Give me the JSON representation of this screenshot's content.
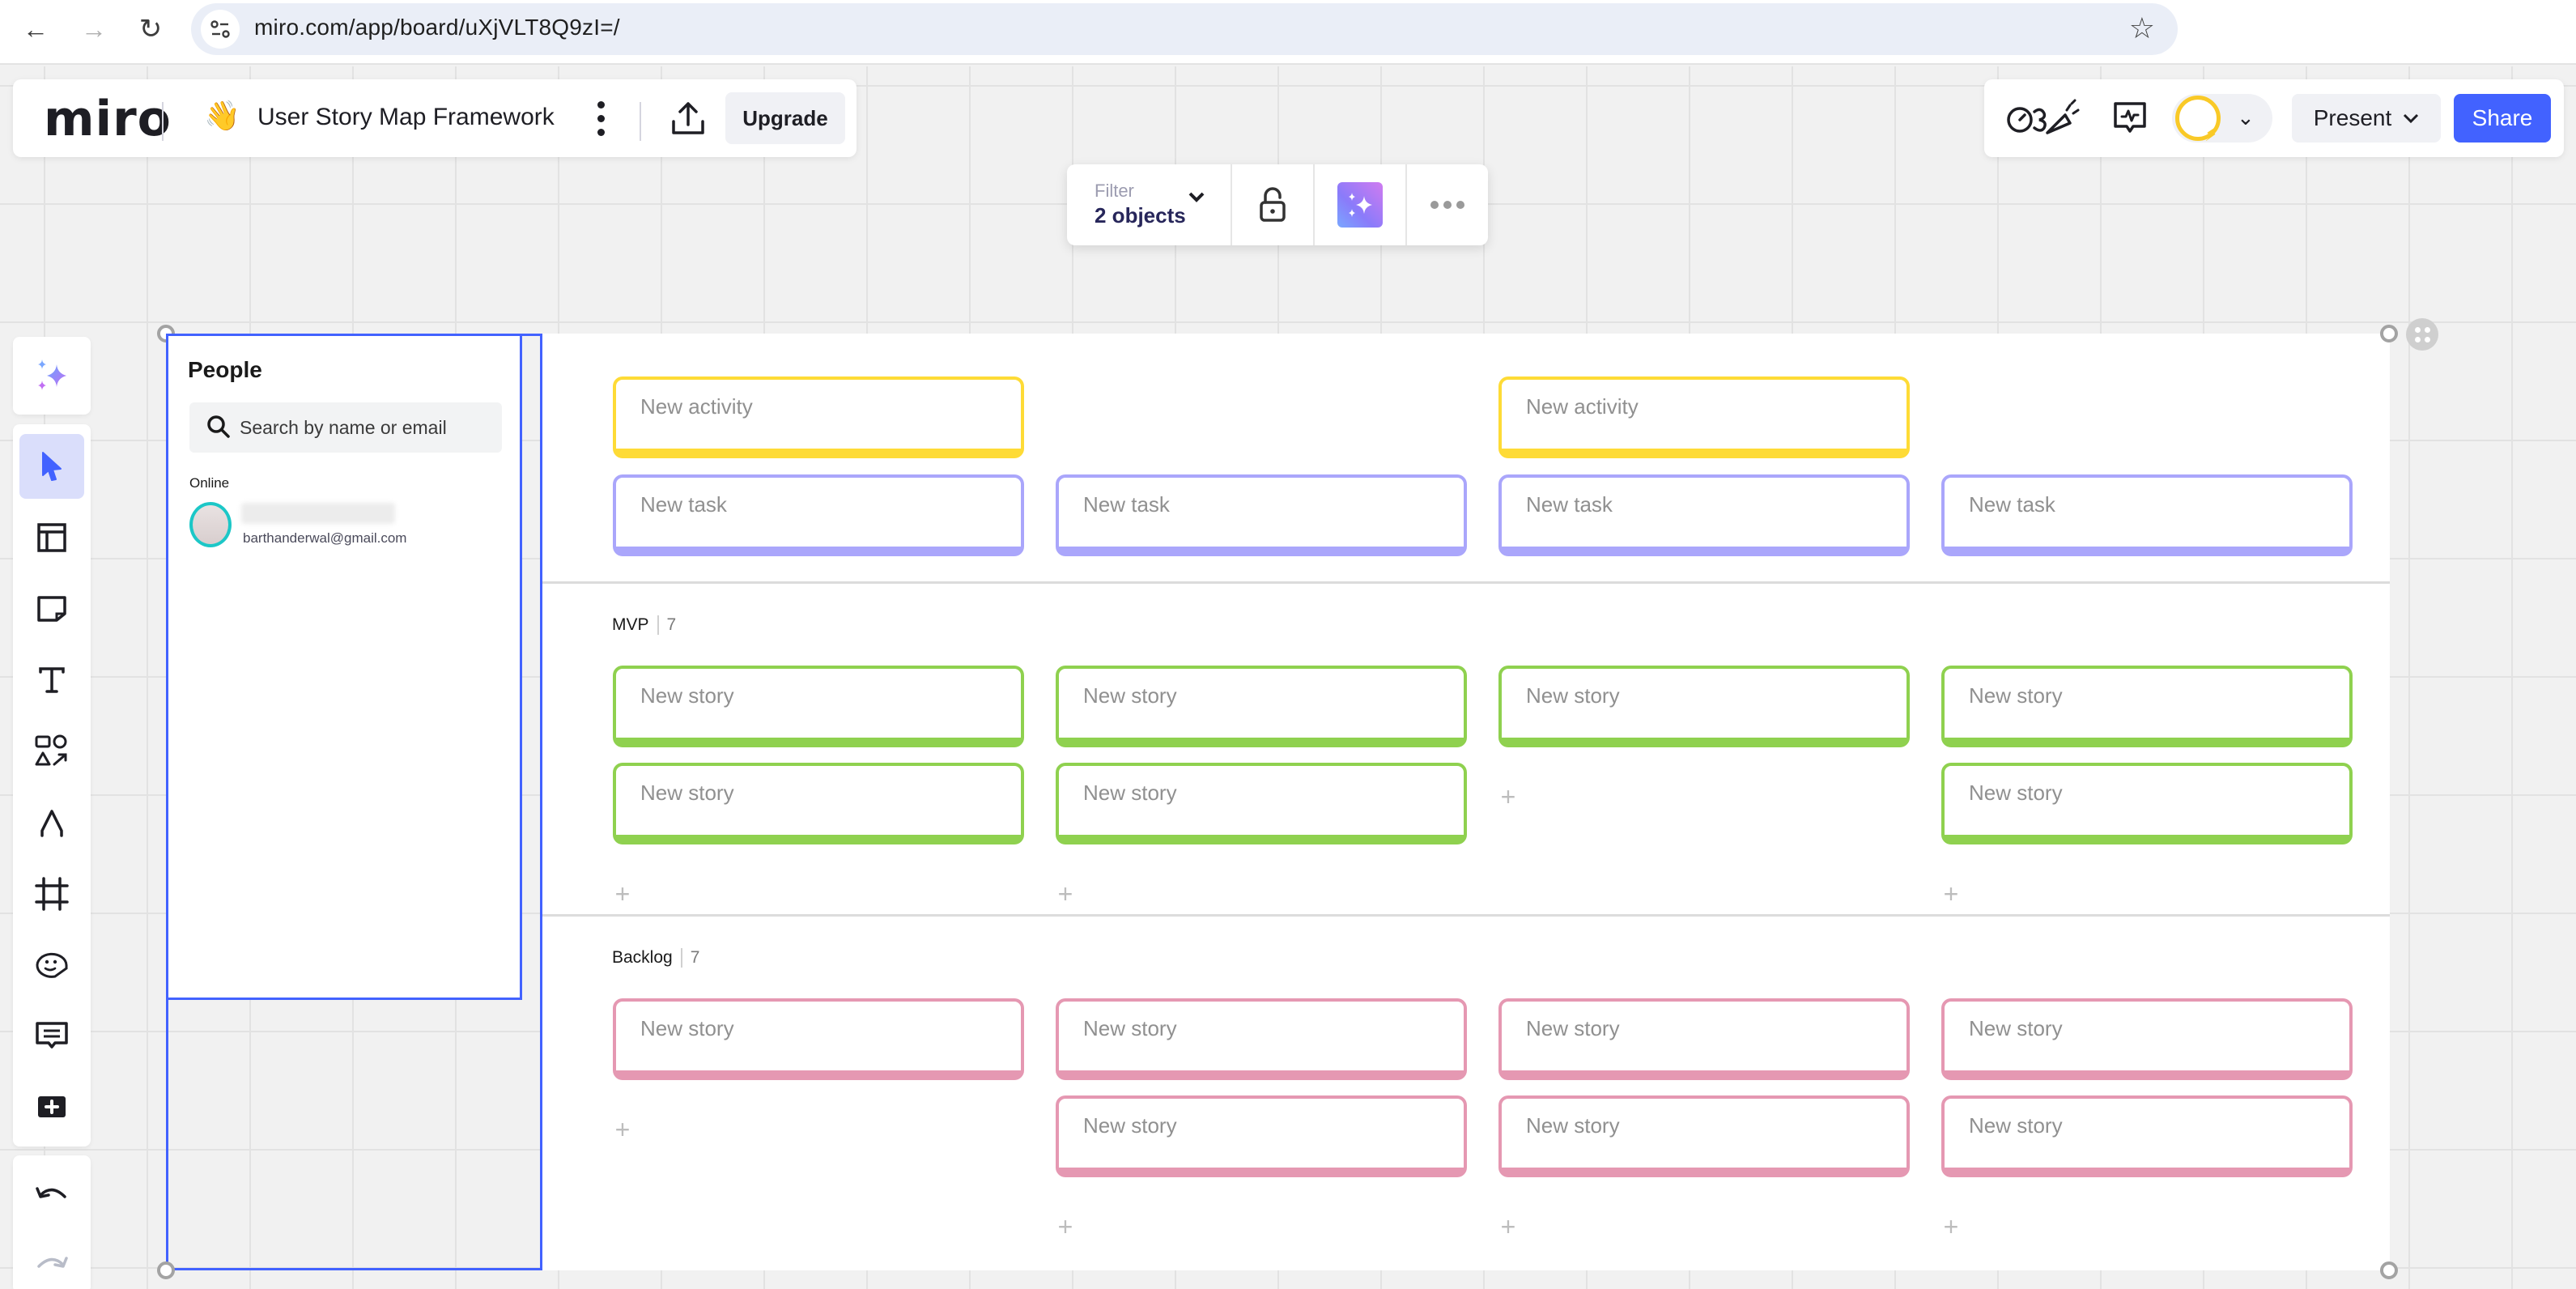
{
  "browser": {
    "url": "miro.com/app/board/uXjVLT8Q9zI=/",
    "back_icon": "arrow-left-icon",
    "forward_icon": "arrow-right-icon",
    "reload_icon": "reload-icon",
    "site_info_icon": "tune-icon",
    "bookmark_icon": "star-icon"
  },
  "header": {
    "logo": "miro",
    "board_emoji": "👋",
    "board_title": "User Story Map Framework",
    "upgrade_label": "Upgrade"
  },
  "right_toolbar": {
    "present_label": "Present",
    "share_label": "Share",
    "accent_color": "#4262ff"
  },
  "context_toolbar": {
    "filter_label": "Filter",
    "filter_value": "2 objects"
  },
  "tools": [
    {
      "name": "ai-assist",
      "icon": "sparkles-icon"
    },
    {
      "name": "select",
      "icon": "cursor-icon",
      "active": true
    },
    {
      "name": "templates",
      "icon": "layout-icon"
    },
    {
      "name": "sticky-note",
      "icon": "sticky-note-icon"
    },
    {
      "name": "text",
      "icon": "text-icon"
    },
    {
      "name": "shapes",
      "icon": "shapes-icon"
    },
    {
      "name": "pen",
      "icon": "pen-icon"
    },
    {
      "name": "frame",
      "icon": "frame-icon"
    },
    {
      "name": "stickers",
      "icon": "sticker-icon"
    },
    {
      "name": "comment",
      "icon": "comment-icon"
    },
    {
      "name": "more-apps",
      "icon": "plus-square-icon"
    },
    {
      "name": "undo",
      "icon": "undo-icon"
    },
    {
      "name": "redo",
      "icon": "redo-icon"
    }
  ],
  "people": {
    "title": "People",
    "search_placeholder": "Search by name or email",
    "online_label": "Online",
    "users": [
      {
        "email": "barthanderwal@gmail.com"
      }
    ]
  },
  "story_map": {
    "colors": {
      "activity": "#fedb36",
      "task": "#aaa6fb",
      "mvp": "#8fd14f",
      "backlog": "#e598b2"
    },
    "activities": [
      "New activity",
      "New activity"
    ],
    "tasks": [
      "New task",
      "New task",
      "New task",
      "New task"
    ],
    "lanes": [
      {
        "name": "MVP",
        "count": "7",
        "columns": [
          [
            "New story",
            "New story"
          ],
          [
            "New story",
            "New story"
          ],
          [
            "New story"
          ],
          [
            "New story",
            "New story"
          ]
        ]
      },
      {
        "name": "Backlog",
        "count": "7",
        "columns": [
          [
            "New story"
          ],
          [
            "New story",
            "New story"
          ],
          [
            "New story",
            "New story"
          ],
          [
            "New story",
            "New story"
          ]
        ]
      }
    ],
    "add_label": "+"
  }
}
